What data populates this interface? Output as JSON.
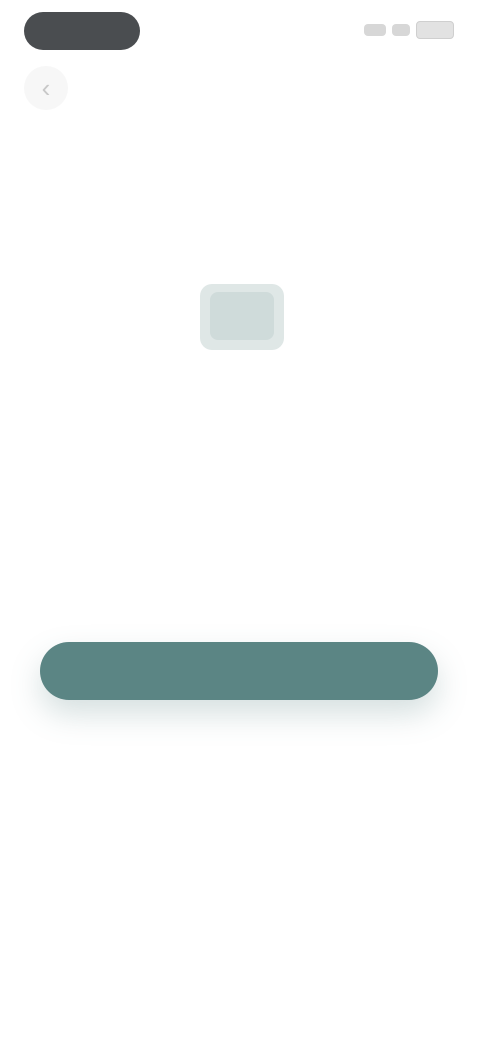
{
  "status_bar": {
    "pill_icon": "dynamic-island",
    "signal_icon": "signal-icon",
    "wifi_icon": "wifi-icon",
    "battery_icon": "battery-icon"
  },
  "nav": {
    "back_icon": "chevron-left-icon",
    "back_glyph": "‹"
  },
  "hero": {
    "icon": "wallet-icon",
    "title": "",
    "subtitle": ""
  },
  "actions": {
    "primary_label": "",
    "secondary_label": ""
  },
  "footer": {
    "note": ""
  },
  "colors": {
    "accent": "#5b8584",
    "background": "#ffffff"
  }
}
